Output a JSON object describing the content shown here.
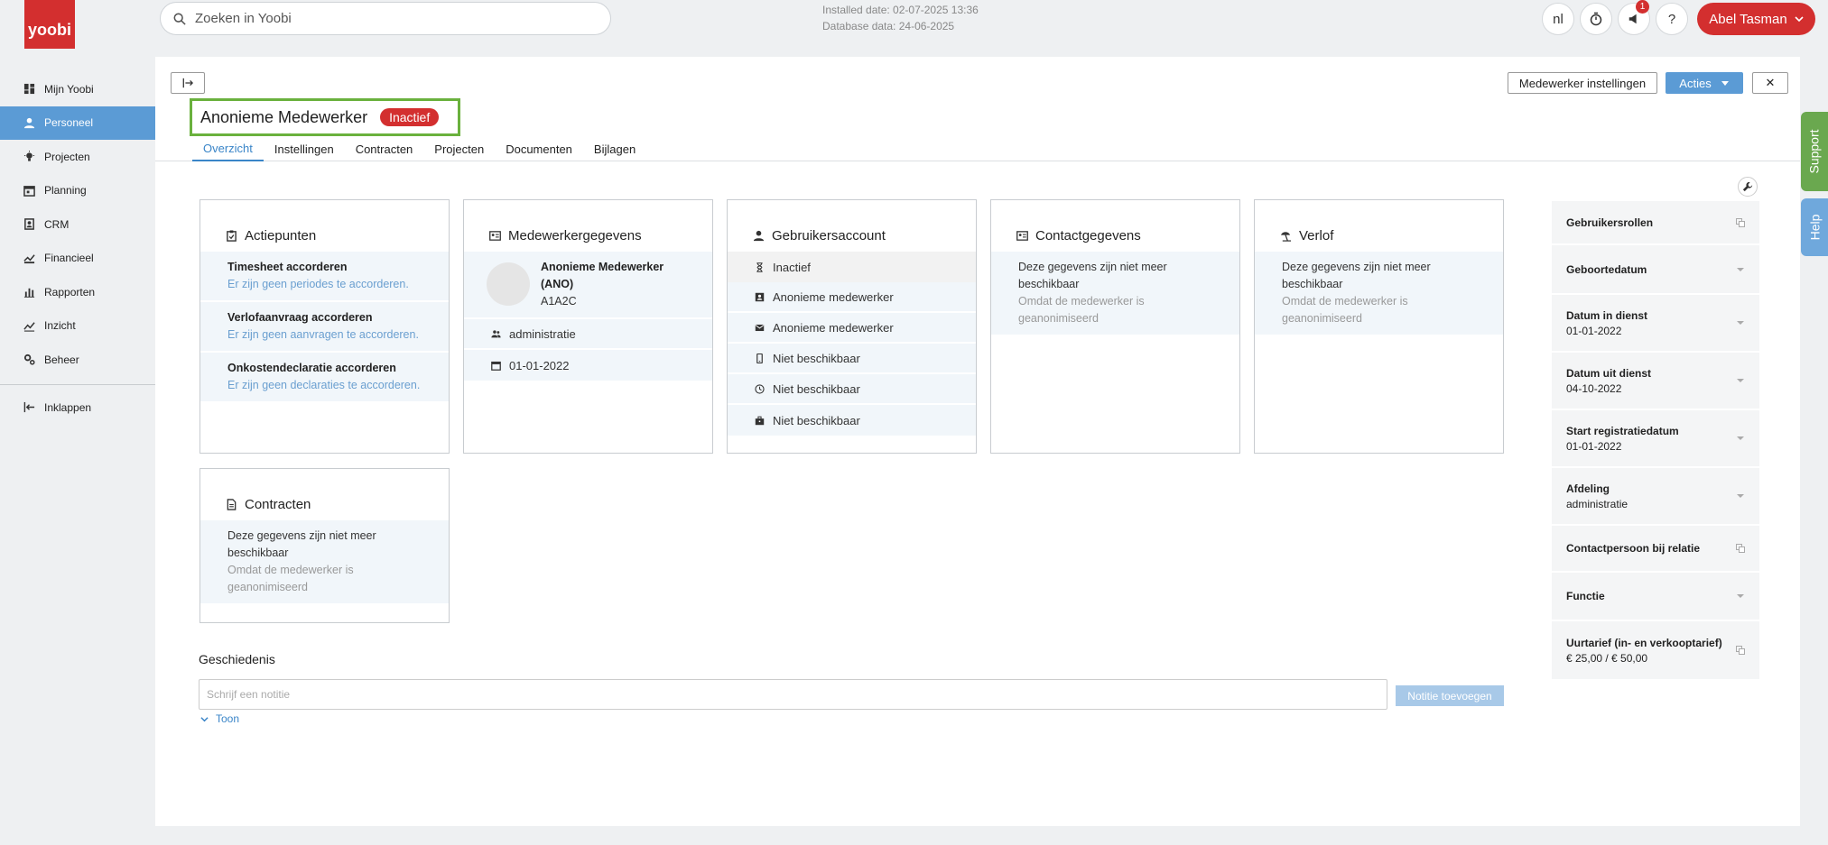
{
  "app": {
    "logo_text": "yoobi"
  },
  "search": {
    "placeholder": "Zoeken in Yoobi"
  },
  "install_info": {
    "installed": "Installed date: 02-07-2025 13:36",
    "database": "Database data: 24-06-2025"
  },
  "topbar": {
    "language": "nl",
    "notification_count": "1",
    "help": "?",
    "user_name": "Abel Tasman"
  },
  "sidebar": {
    "items": [
      {
        "label": "Mijn Yoobi",
        "icon": "dashboard-icon"
      },
      {
        "label": "Personeel",
        "icon": "person-icon",
        "active": true
      },
      {
        "label": "Projecten",
        "icon": "lightbulb-icon"
      },
      {
        "label": "Planning",
        "icon": "calendar-icon"
      },
      {
        "label": "CRM",
        "icon": "contacts-icon"
      },
      {
        "label": "Financieel",
        "icon": "money-icon"
      },
      {
        "label": "Rapporten",
        "icon": "bar-chart-icon"
      },
      {
        "label": "Inzicht",
        "icon": "trend-icon"
      },
      {
        "label": "Beheer",
        "icon": "gears-icon"
      }
    ],
    "collapse_label": "Inklappen"
  },
  "header": {
    "employee_name": "Anonieme Medewerker",
    "status": "Inactief",
    "settings_button": "Medewerker instellingen",
    "actions_button": "Acties",
    "close": "✕"
  },
  "tabs": [
    "Overzicht",
    "Instellingen",
    "Contracten",
    "Projecten",
    "Documenten",
    "Bijlagen"
  ],
  "cards": {
    "actiepunten": {
      "title": "Actiepunten",
      "items": [
        {
          "head": "Timesheet accorderen",
          "sub": "Er zijn geen periodes te accorderen."
        },
        {
          "head": "Verlofaanvraag accorderen",
          "sub": "Er zijn geen aanvragen te accorderen."
        },
        {
          "head": "Onkostendeclaratie accorderen",
          "sub": "Er zijn geen declaraties te accorderen."
        }
      ]
    },
    "medewerker": {
      "title": "Medewerkergegevens",
      "name": "Anonieme Medewerker (ANO)",
      "code": "A1A2C",
      "department": "administratie",
      "date": "01-01-2022"
    },
    "account": {
      "title": "Gebruikersaccount",
      "rows": [
        "Inactief",
        "Anonieme medewerker",
        "Anonieme medewerker",
        "Niet beschikbaar",
        "Niet beschikbaar",
        "Niet beschikbaar"
      ]
    },
    "contact": {
      "title": "Contactgegevens",
      "line1": "Deze gegevens zijn niet meer beschikbaar",
      "line2": "Omdat de medewerker is geanonimiseerd"
    },
    "verlof": {
      "title": "Verlof",
      "line1": "Deze gegevens zijn niet meer beschikbaar",
      "line2": "Omdat de medewerker is geanonimiseerd"
    },
    "contracten": {
      "title": "Contracten",
      "line1": "Deze gegevens zijn niet meer beschikbaar",
      "line2": "Omdat de medewerker is geanonimiseerd"
    }
  },
  "history": {
    "title": "Geschiedenis",
    "placeholder": "Schrijf een notitie",
    "add_button": "Notitie toevoegen",
    "toggle": "Toon"
  },
  "fields": [
    {
      "label": "Gebruikersrollen",
      "value": "",
      "icon": "copy-icon"
    },
    {
      "label": "Geboortedatum",
      "value": "",
      "icon": "caret-icon"
    },
    {
      "label": "Datum in dienst",
      "value": "01-01-2022",
      "icon": "caret-icon"
    },
    {
      "label": "Datum uit dienst",
      "value": "04-10-2022",
      "icon": "caret-icon"
    },
    {
      "label": "Start registratiedatum",
      "value": "01-01-2022",
      "icon": "caret-icon"
    },
    {
      "label": "Afdeling",
      "value": "administratie",
      "icon": "caret-icon"
    },
    {
      "label": "Contactpersoon bij relatie",
      "value": "",
      "icon": "copy-icon"
    },
    {
      "label": "Functie",
      "value": "",
      "icon": "caret-icon"
    },
    {
      "label": "Uurtarief (in- en verkooptarief)",
      "value": "€ 25,00 / € 50,00",
      "icon": "copy-icon"
    }
  ],
  "side_tabs": {
    "support": "Support",
    "help": "Help"
  },
  "colors": {
    "brand": "#d32f2f",
    "accent": "#5b9bd5",
    "highlight": "#6ab13d",
    "support": "#6aa84f",
    "help": "#6fa8dc"
  }
}
